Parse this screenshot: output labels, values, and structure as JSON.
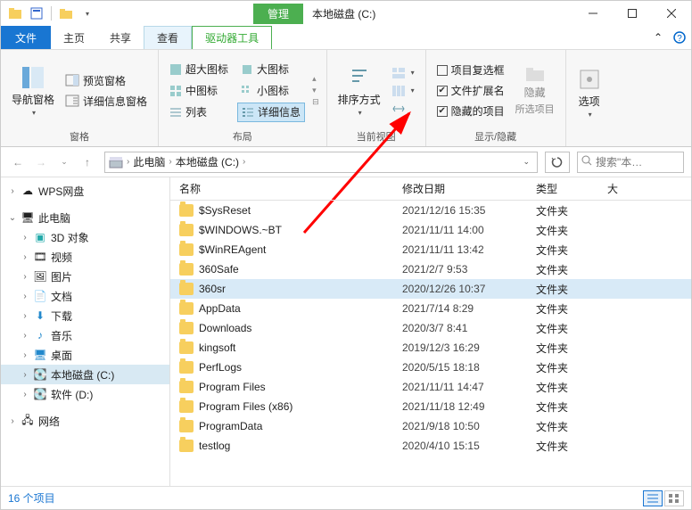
{
  "title": {
    "manage": "管理",
    "window_title": "本地磁盘 (C:)"
  },
  "tabs": {
    "file": "文件",
    "home": "主页",
    "share": "共享",
    "view": "查看",
    "drive_tools": "驱动器工具"
  },
  "ribbon": {
    "panes": {
      "nav_pane": "导航窗格",
      "preview_pane": "预览窗格",
      "details_pane": "详细信息窗格",
      "group_label": "窗格"
    },
    "layout": {
      "extra_large": "超大图标",
      "large": "大图标",
      "medium": "中图标",
      "small": "小图标",
      "list": "列表",
      "details": "详细信息",
      "group_label": "布局"
    },
    "current_view": {
      "sort": "排序方式",
      "group_label": "当前视图"
    },
    "show_hide": {
      "checkboxes": "项目复选框",
      "extensions": "文件扩展名",
      "hidden": "隐藏的项目",
      "hide_selected": "隐藏",
      "hide_selected_sub": "所选项目",
      "group_label": "显示/隐藏"
    },
    "options": {
      "label": "选项"
    }
  },
  "breadcrumb": {
    "this_pc": "此电脑",
    "drive": "本地磁盘 (C:)"
  },
  "search": {
    "placeholder": "搜索\"本…"
  },
  "sidebar": {
    "wps": "WPS网盘",
    "this_pc": "此电脑",
    "objects": "3D 对象",
    "videos": "视频",
    "pictures": "图片",
    "documents": "文档",
    "downloads": "下载",
    "music": "音乐",
    "desktop": "桌面",
    "c_drive": "本地磁盘 (C:)",
    "d_drive": "软件 (D:)",
    "network": "网络"
  },
  "columns": {
    "name": "名称",
    "date": "修改日期",
    "type": "类型",
    "size": "大"
  },
  "files": [
    {
      "name": "$SysReset",
      "date": "2021/12/16 15:35",
      "type": "文件夹"
    },
    {
      "name": "$WINDOWS.~BT",
      "date": "2021/11/11 14:00",
      "type": "文件夹"
    },
    {
      "name": "$WinREAgent",
      "date": "2021/11/11 13:42",
      "type": "文件夹"
    },
    {
      "name": "360Safe",
      "date": "2021/2/7 9:53",
      "type": "文件夹"
    },
    {
      "name": "360sr",
      "date": "2020/12/26 10:37",
      "type": "文件夹",
      "selected": true
    },
    {
      "name": "AppData",
      "date": "2021/7/14 8:29",
      "type": "文件夹"
    },
    {
      "name": "Downloads",
      "date": "2020/3/7 8:41",
      "type": "文件夹"
    },
    {
      "name": "kingsoft",
      "date": "2019/12/3 16:29",
      "type": "文件夹"
    },
    {
      "name": "PerfLogs",
      "date": "2020/5/15 18:18",
      "type": "文件夹"
    },
    {
      "name": "Program Files",
      "date": "2021/11/11 14:47",
      "type": "文件夹"
    },
    {
      "name": "Program Files (x86)",
      "date": "2021/11/18 12:49",
      "type": "文件夹"
    },
    {
      "name": "ProgramData",
      "date": "2021/9/18 10:50",
      "type": "文件夹"
    },
    {
      "name": "testlog",
      "date": "2020/4/10 15:15",
      "type": "文件夹"
    }
  ],
  "status": {
    "count": "16 个项目"
  },
  "colors": {
    "accent": "#1976D2",
    "ribbon_green": "#4CAF50",
    "arrow": "#FF0000"
  }
}
